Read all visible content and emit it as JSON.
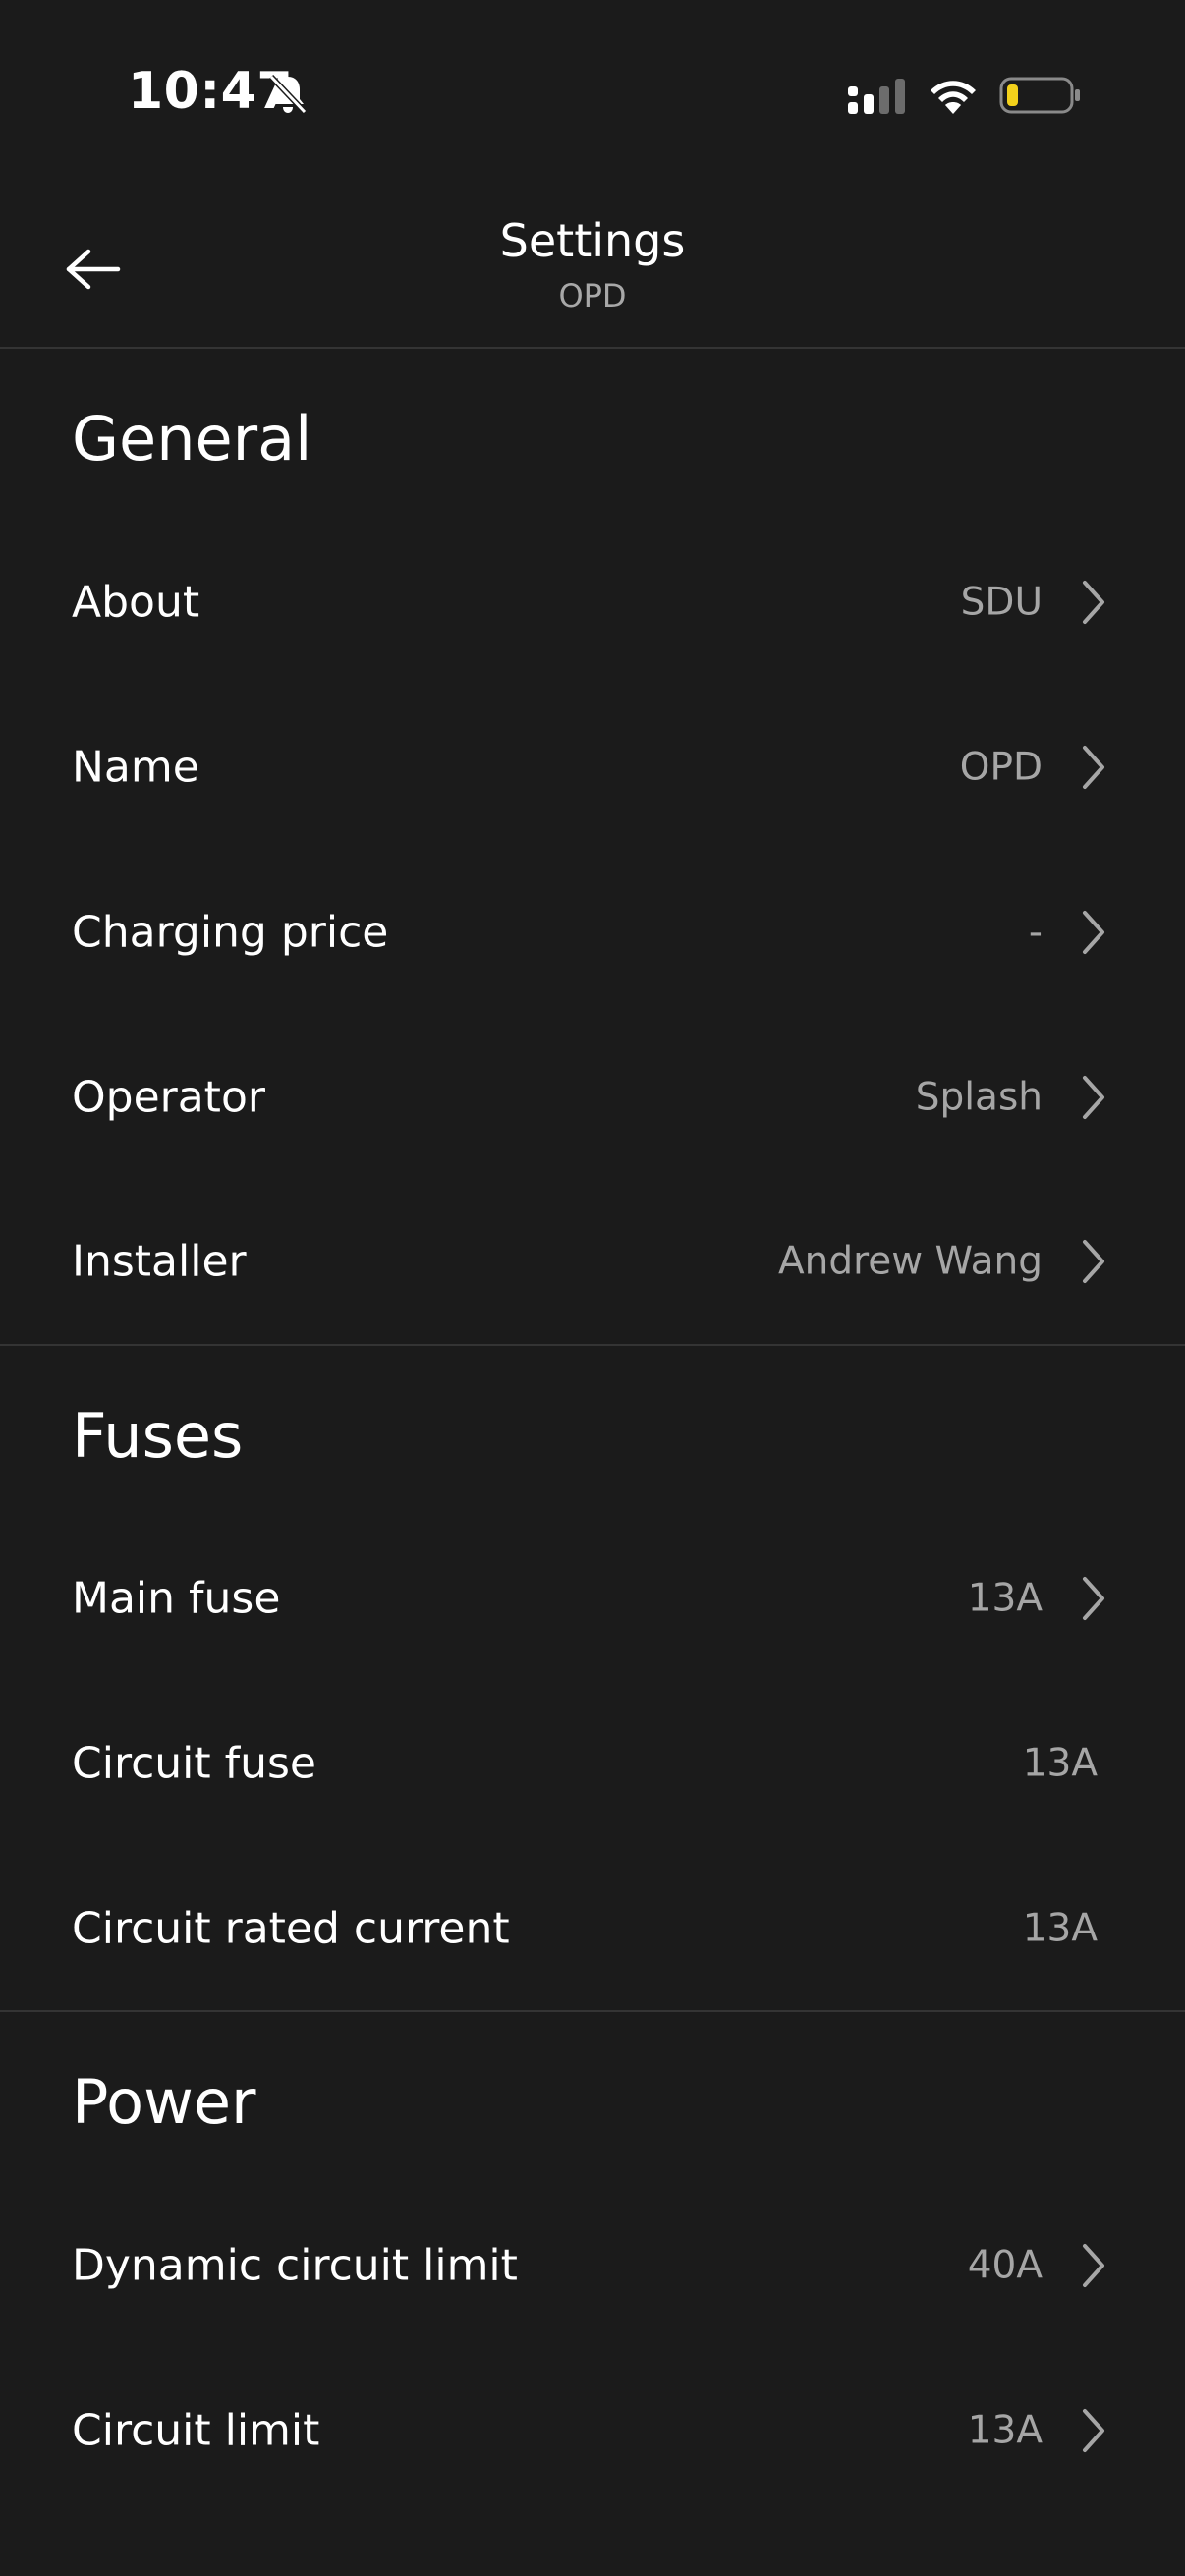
{
  "status_bar": {
    "time": "10:47",
    "icons": [
      "bell-muted-icon",
      "signal-icon",
      "wifi-icon",
      "battery-low-icon"
    ],
    "battery_color": "#f3d11b"
  },
  "header": {
    "back_icon": "arrow-left-icon",
    "title": "Settings",
    "subtitle": "OPD"
  },
  "sections": {
    "general": {
      "title": "General",
      "rows": [
        {
          "label": "About",
          "value": "SDU"
        },
        {
          "label": "Name",
          "value": "OPD"
        },
        {
          "label": "Charging price",
          "value": "-"
        },
        {
          "label": "Operator",
          "value": "Splash"
        },
        {
          "label": "Installer",
          "value": "Andrew Wang"
        }
      ]
    },
    "fuses": {
      "title": "Fuses",
      "rows": [
        {
          "label": "Main fuse",
          "value": "13A"
        },
        {
          "label": "Circuit fuse",
          "value": "13A"
        },
        {
          "label": "Circuit rated current",
          "value": "13A"
        }
      ]
    },
    "power": {
      "title": "Power",
      "rows": [
        {
          "label": "Dynamic circuit limit",
          "value": "40A"
        },
        {
          "label": "Circuit limit",
          "value": "13A"
        }
      ]
    }
  },
  "colors": {
    "background": "#1b1b1b",
    "divider": "#343434",
    "primary_text": "#ffffff",
    "secondary_text": "#a6a6a6"
  }
}
